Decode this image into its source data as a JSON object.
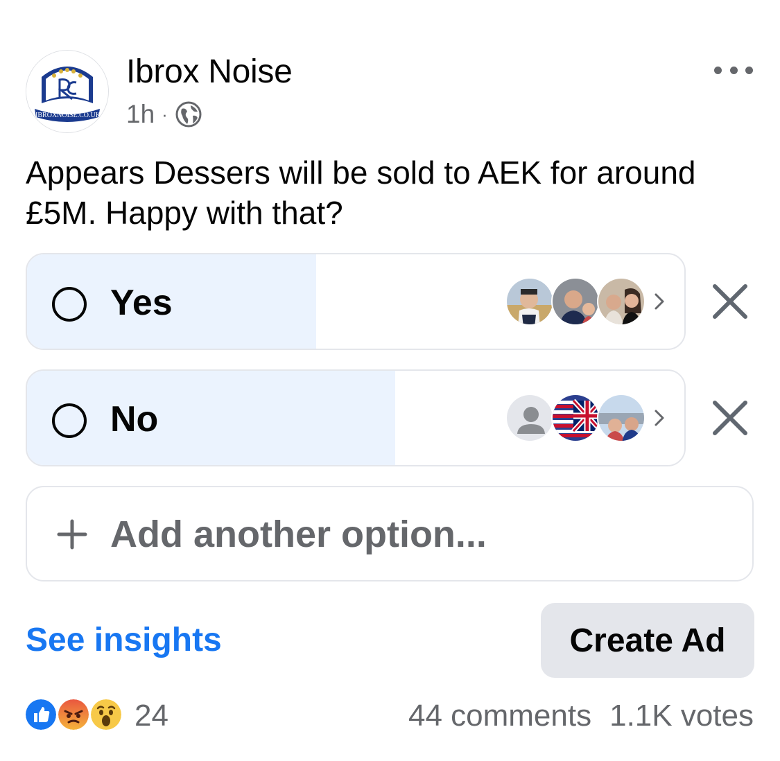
{
  "post": {
    "page_name": "Ibrox Noise",
    "timestamp": "1h",
    "separator": "·",
    "audience_icon": "globe-icon",
    "logo_text": "IBROXNOISE.CO.UK",
    "text": "Appears Dessers will be sold to AEK for around £5M. Happy with that?"
  },
  "poll": {
    "options": [
      {
        "label": "Yes",
        "vote_share": 0.44,
        "voter_icons": [
          "voter-avatar",
          "voter-avatar",
          "voter-avatar"
        ]
      },
      {
        "label": "No",
        "vote_share": 0.56,
        "voter_icons": [
          "default-person-avatar",
          "flag-avatar",
          "voter-avatar"
        ]
      }
    ],
    "add_option_label": "Add another option..."
  },
  "actions": {
    "insights_label": "See insights",
    "create_ad_label": "Create Ad"
  },
  "footer": {
    "reaction_icons": [
      "like-icon",
      "angry-icon",
      "wow-icon"
    ],
    "reaction_count": "24",
    "comments": "44 comments",
    "votes": "1.1K votes"
  },
  "colors": {
    "accent": "#1877f2",
    "poll_fill": "#ebf3fe",
    "secondary_text": "#65676b",
    "button_bg": "#e4e6eb"
  }
}
